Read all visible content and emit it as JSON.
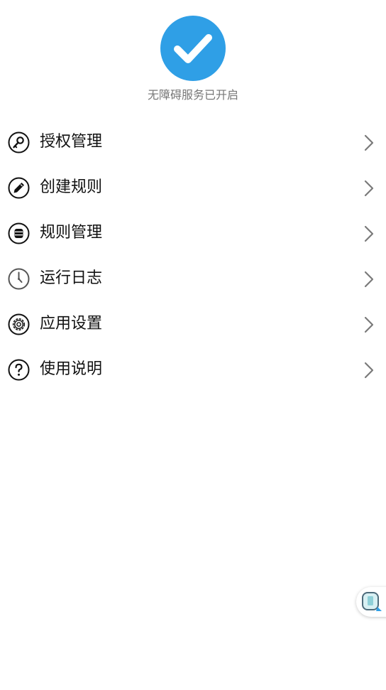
{
  "status": {
    "text": "无障碍服务已开启",
    "badge_color": "#2f9fe6",
    "icon": "checkmark-icon"
  },
  "menu": {
    "items": [
      {
        "label": "授权管理",
        "icon": "key-icon"
      },
      {
        "label": "创建规则",
        "icon": "pencil-icon"
      },
      {
        "label": "规则管理",
        "icon": "database-icon"
      },
      {
        "label": "运行日志",
        "icon": "clock-icon"
      },
      {
        "label": "应用设置",
        "icon": "gear-icon"
      },
      {
        "label": "使用说明",
        "icon": "question-icon"
      }
    ]
  },
  "floating_widget": {
    "icon": "floating-assistant-icon"
  }
}
